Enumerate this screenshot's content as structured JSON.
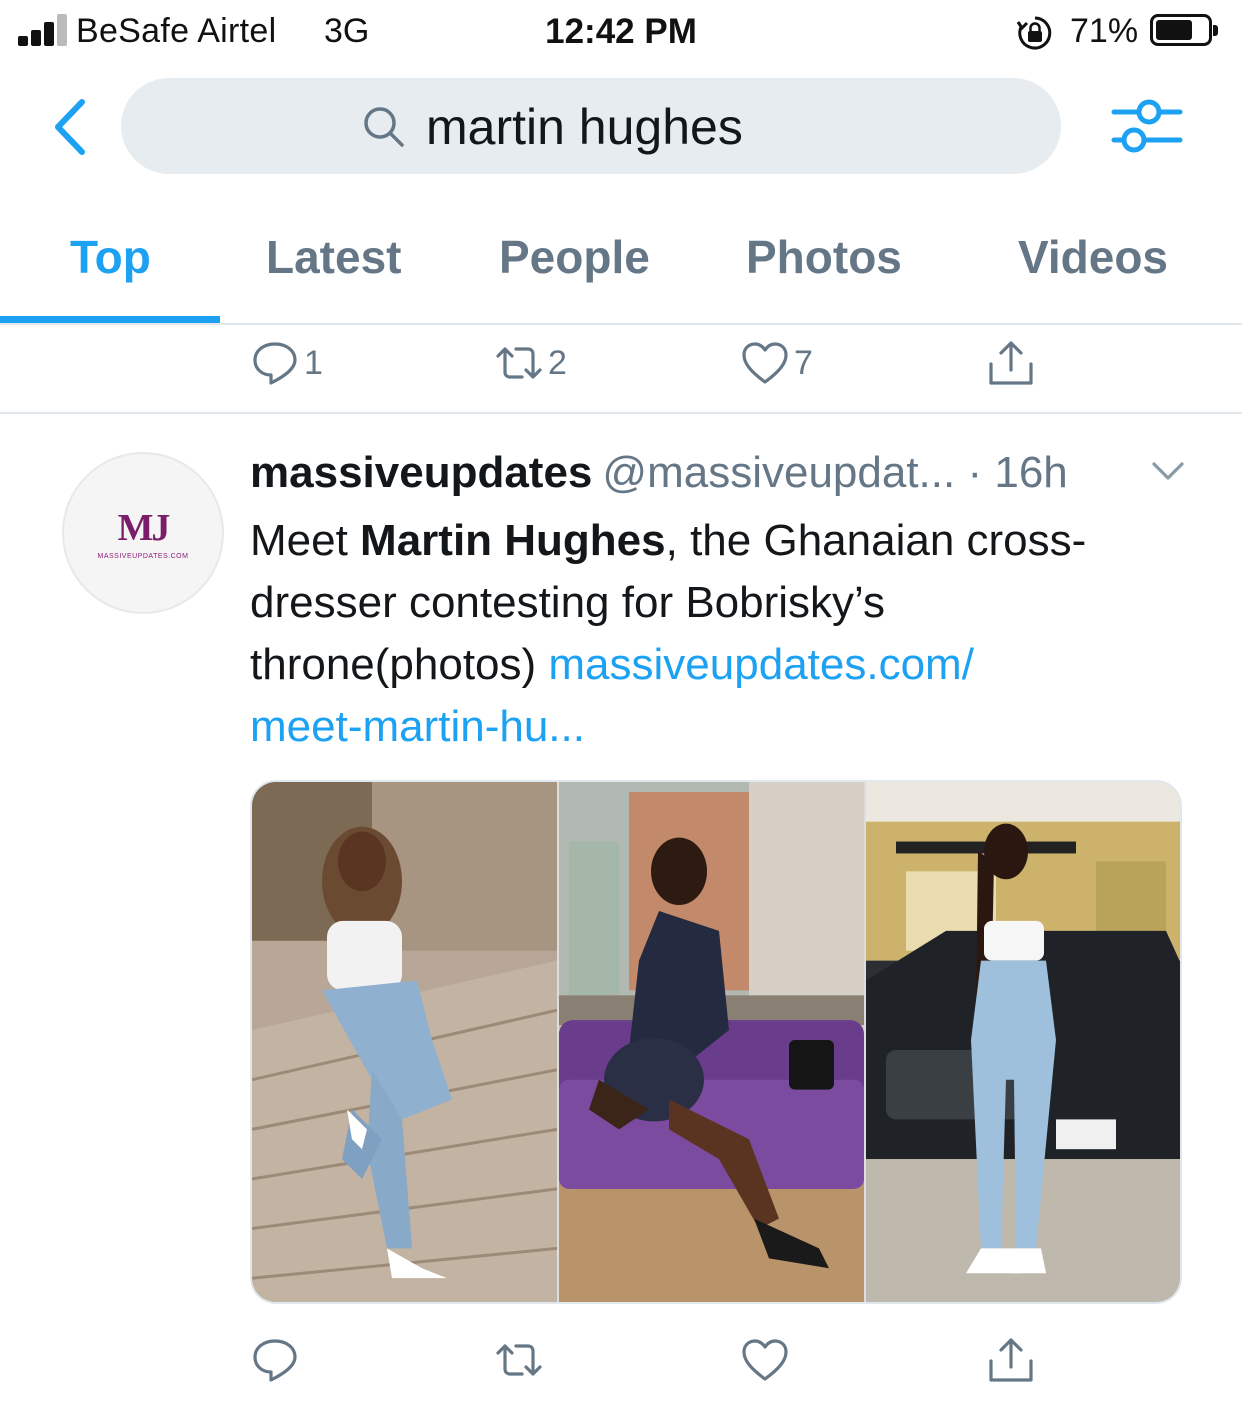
{
  "status_bar": {
    "carrier": "BeSafe Airtel",
    "network": "3G",
    "time": "12:42 PM",
    "battery_percent": "71%",
    "battery_level": 0.71
  },
  "search": {
    "query": "martin hughes",
    "icon": "search-icon"
  },
  "tabs": [
    {
      "label": "Top",
      "active": true
    },
    {
      "label": "Latest",
      "active": false
    },
    {
      "label": "People",
      "active": false
    },
    {
      "label": "Photos",
      "active": false
    },
    {
      "label": "Videos",
      "active": false
    }
  ],
  "previous_tweet_actions": {
    "reply_count": "1",
    "retweet_count": "2",
    "like_count": "7"
  },
  "tweet": {
    "display_name": "massiveupdates",
    "handle": "@massiveupdat...",
    "separator": " · ",
    "time": "16h",
    "avatar_logo": "MJ",
    "avatar_subtext": "MASSIVEUPDATES.COM",
    "text_before": "Meet ",
    "text_bold": "Martin Hughes",
    "text_after": ", the Ghanaian cross-dresser contesting for Bobrisky’s throne(photos) ",
    "link_line1": "massiveupdates.com/",
    "link_line2": "meet-martin-hu...",
    "photo_count": 3
  },
  "colors": {
    "accent": "#1da1f2",
    "secondary_text": "#657786",
    "primary_text": "#14171a",
    "search_bg": "#e6ecf0"
  }
}
